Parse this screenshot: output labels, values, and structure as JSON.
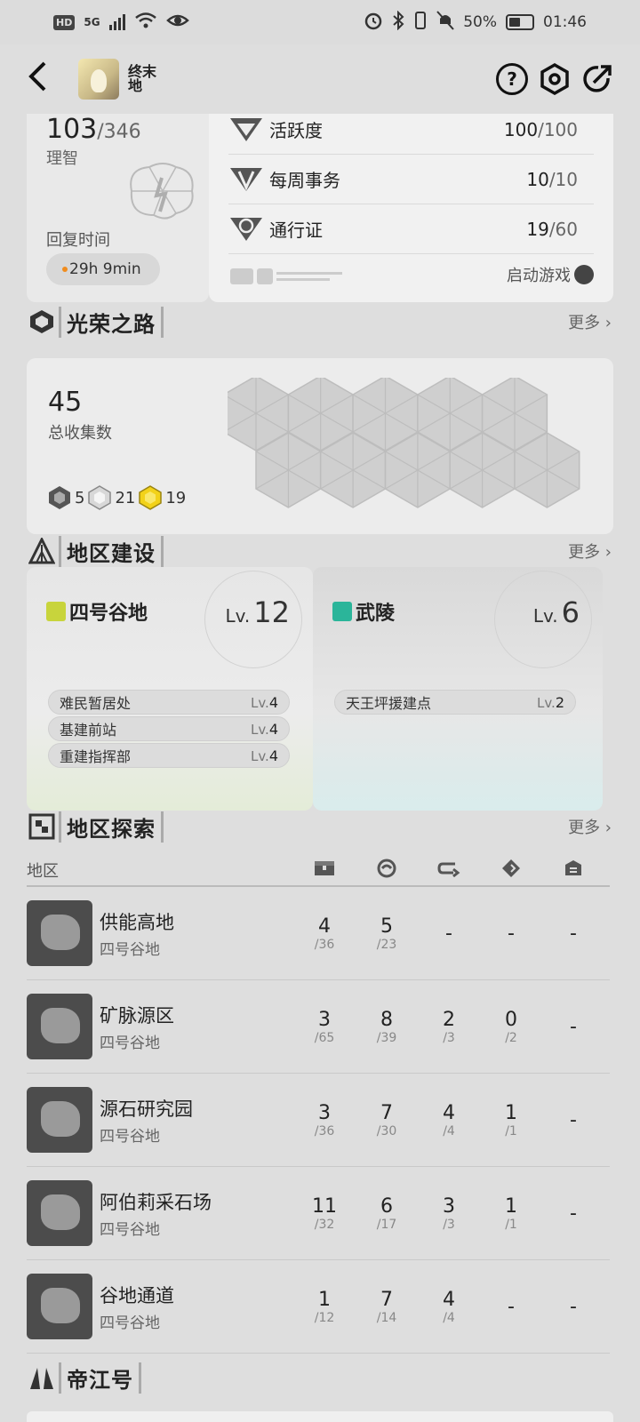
{
  "status_bar": {
    "hd": "HD",
    "net": "5G",
    "battery_pct": "50%",
    "time": "01:46"
  },
  "header": {
    "logo_text": "终末地",
    "help_icon": "?"
  },
  "sanity": {
    "current": "103",
    "max": "/346",
    "label": "理智",
    "recover_label": "回复时间",
    "recover_time": "29h 9min"
  },
  "stats": [
    {
      "name": "活跃度",
      "value": "100",
      "max": "/100",
      "icon": "endfield-icon"
    },
    {
      "name": "每周事务",
      "value": "10",
      "max": "/10",
      "icon": "weekly-icon"
    },
    {
      "name": "通行证",
      "value": "19",
      "max": "/60",
      "icon": "pass-icon"
    }
  ],
  "launch_game": "启动游戏",
  "glory": {
    "title": "光荣之路",
    "more": "更多 ›",
    "total": "45",
    "total_label": "总收集数",
    "badges": [
      {
        "color": "#555555",
        "count": "5"
      },
      {
        "color": "#d8d8d8",
        "count": "21"
      },
      {
        "color": "#f2d21a",
        "count": "19"
      }
    ]
  },
  "region_build": {
    "title": "地区建设",
    "more": "更多 ›",
    "regions": [
      {
        "name": "四号谷地",
        "tag_color": "#c8d43c",
        "lv_prefix": "Lv.",
        "lv": "12",
        "facilities": [
          {
            "name": "难民暂居处",
            "lv_prefix": "Lv.",
            "lv": "4"
          },
          {
            "name": "基建前站",
            "lv_prefix": "Lv.",
            "lv": "4"
          },
          {
            "name": "重建指挥部",
            "lv_prefix": "Lv.",
            "lv": "4"
          }
        ]
      },
      {
        "name": "武陵",
        "tag_color": "#2bb59a",
        "lv_prefix": "Lv.",
        "lv": "6",
        "facilities": [
          {
            "name": "天王坪援建点",
            "lv_prefix": "Lv.",
            "lv": "2"
          }
        ]
      }
    ]
  },
  "exploration": {
    "title": "地区探索",
    "more": "更多 ›",
    "col_region": "地区",
    "rows": [
      {
        "name": "供能高地",
        "sub": "四号谷地",
        "cells": [
          [
            "4",
            "/36"
          ],
          [
            "5",
            "/23"
          ],
          [
            "-",
            ""
          ],
          [
            "-",
            ""
          ],
          [
            "-",
            ""
          ]
        ]
      },
      {
        "name": "矿脉源区",
        "sub": "四号谷地",
        "cells": [
          [
            "3",
            "/65"
          ],
          [
            "8",
            "/39"
          ],
          [
            "2",
            "/3"
          ],
          [
            "0",
            "/2"
          ],
          [
            "-",
            ""
          ]
        ]
      },
      {
        "name": "源石研究园",
        "sub": "四号谷地",
        "cells": [
          [
            "3",
            "/36"
          ],
          [
            "7",
            "/30"
          ],
          [
            "4",
            "/4"
          ],
          [
            "1",
            "/1"
          ],
          [
            "-",
            ""
          ]
        ]
      },
      {
        "name": "阿伯莉采石场",
        "sub": "四号谷地",
        "cells": [
          [
            "11",
            "/32"
          ],
          [
            "6",
            "/17"
          ],
          [
            "3",
            "/3"
          ],
          [
            "1",
            "/1"
          ],
          [
            "-",
            ""
          ]
        ]
      },
      {
        "name": "谷地通道",
        "sub": "四号谷地",
        "cells": [
          [
            "1",
            "/12"
          ],
          [
            "7",
            "/14"
          ],
          [
            "4",
            "/4"
          ],
          [
            "-",
            ""
          ],
          [
            "-",
            ""
          ]
        ]
      }
    ]
  },
  "dijiang": {
    "title": "帝江号"
  },
  "colors": {
    "accent_dot": "#f08c1e",
    "background": "#dedede"
  }
}
